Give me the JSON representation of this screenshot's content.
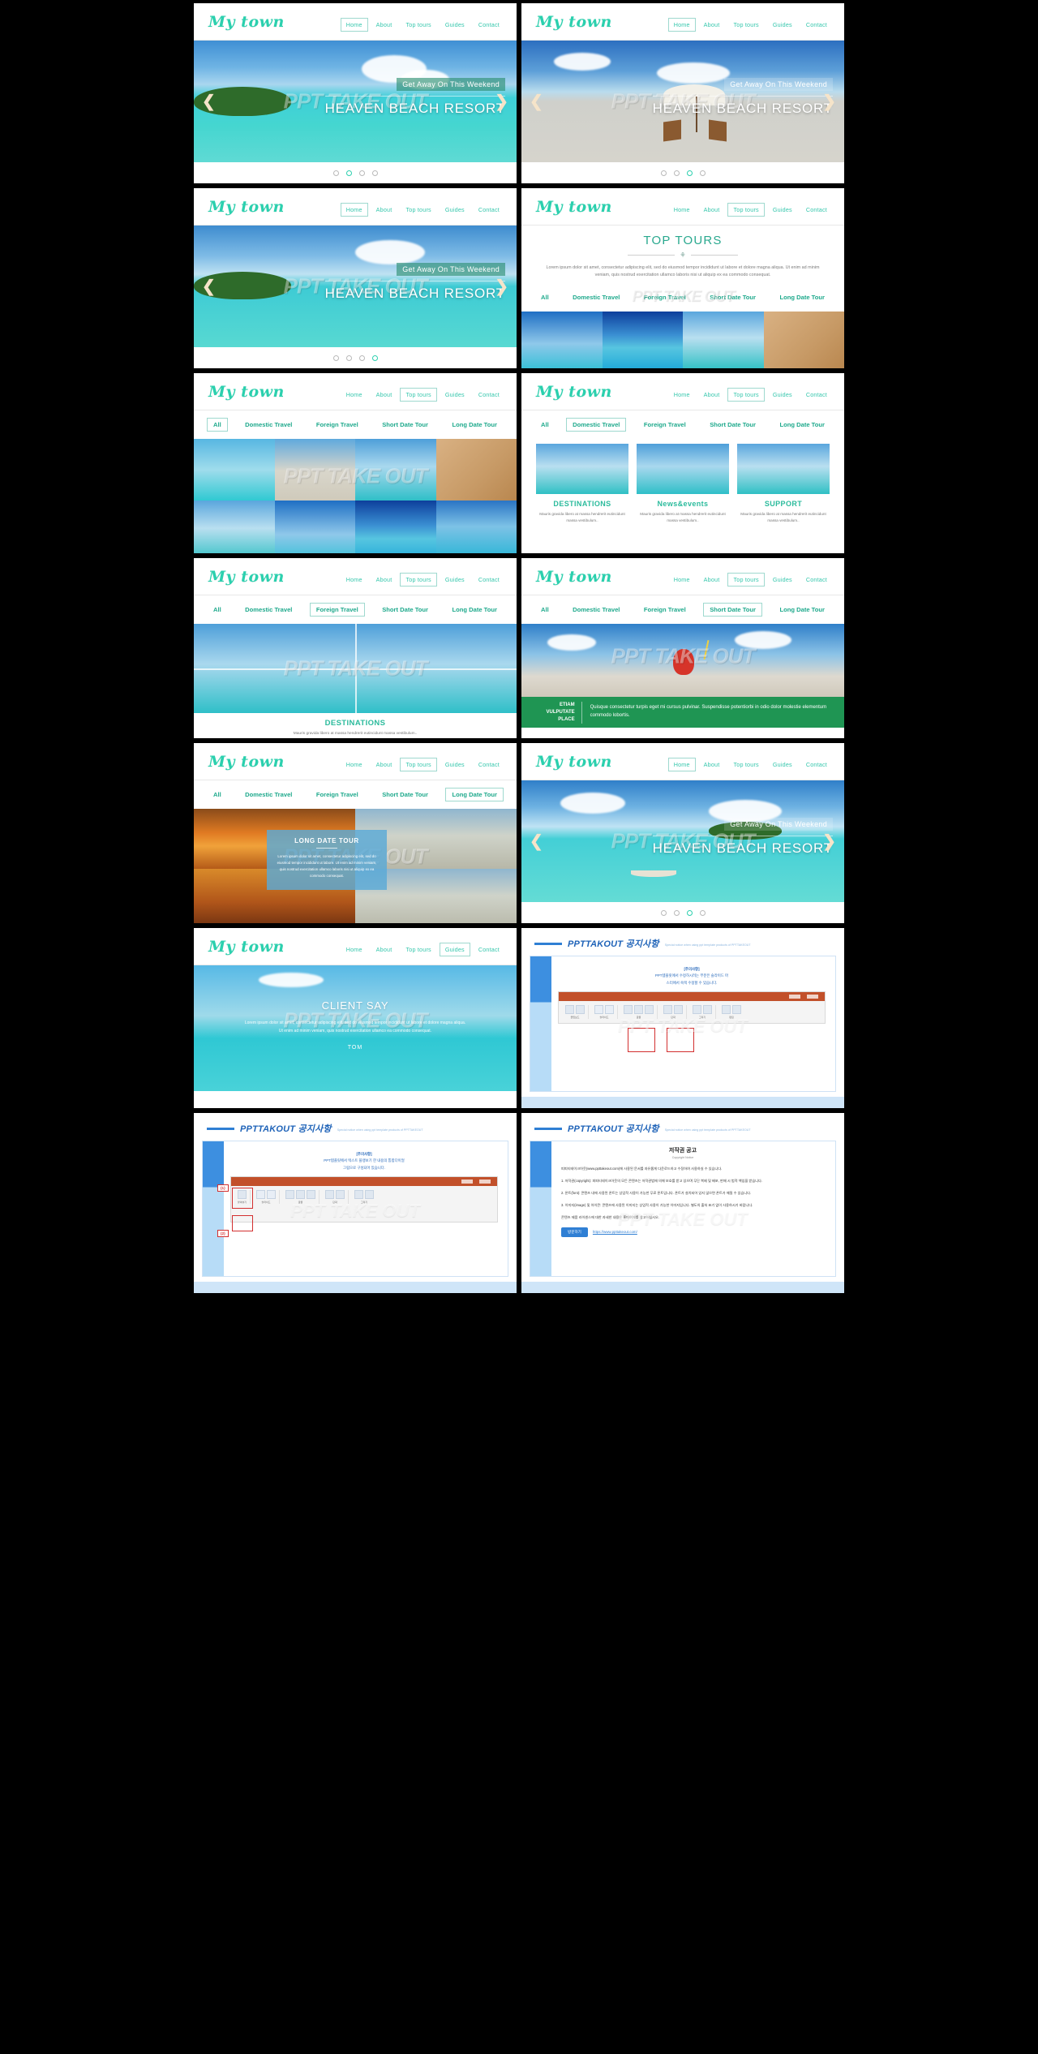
{
  "brand": {
    "logo": "My town"
  },
  "nav": {
    "items": [
      "Home",
      "About",
      "Top tours",
      "Guides",
      "Contact"
    ]
  },
  "hero": {
    "tagline": "Get Away On This Weekend",
    "title": "HEAVEN BEACH RESORT",
    "prev": "❮",
    "next": "❯"
  },
  "watermark": {
    "text": "PPT TAKE OUT"
  },
  "top_tours": {
    "title": "TOP TOURS",
    "ornament": "⚘",
    "description": "Lorem ipsum dolor sit amet, consectetur adipiscing elit, sed do eiusmod tempor incididunt ut labore et dolore magna aliqua. Ut enim ad minim veniam, quis nostrud exercitation ullamco laboris nisi ut aliquip ex ea commodo consequat."
  },
  "filters": {
    "items": [
      "All",
      "Domestic Travel",
      "Foreign Travel",
      "Short Date Tour",
      "Long Date Tour"
    ]
  },
  "features": [
    {
      "title": "DESTINATIONS",
      "text": "Mauris gravida libero at massa hendrerit eutincidunt massa vestibulum.."
    },
    {
      "title": "News&events",
      "text": "Mauris gravida libero at massa hendrerit eutincidunt massa vestibulum.."
    },
    {
      "title": "SUPPORT",
      "text": "Mauris gravida libero at massa hendrerit eutincidunt massa vestibulum.."
    }
  ],
  "destination_banner": {
    "title": "DESTINATIONS",
    "text": "Mauris gravida libero at massa hendrerit eutincidunt massa vestibulum.."
  },
  "etiam": {
    "label_line1": "ETIAM",
    "label_line2": "VULPUTATE PLACE",
    "text": "Quisque consectetur turpis eget mi cursus pulvinar. Suspendisse potentiorbi in odio dolor molestie elementum commodo lobortis."
  },
  "long_date_card": {
    "title": "LONG DATE TOUR",
    "text": "Lorem ipsum dolor sit amet, consectetur adipiscing elit, sed do eiusmod tempor incididunt ut labore. Ut enim ad minim veniam, quis nostrud exercitation ullamco laboris nisi ut aliquip ex ea commodo consequat."
  },
  "client_say": {
    "title": "CLIENT SAY",
    "quote": "Lorem ipsum dolor sit amet, consectetur adipiscing elit, sed do eiusmod tempor incididunt ut labore et dolore magna aliqua. Ut enim ad minim veniam, quis nostrud exercitation ullamco ea commodo consequat.",
    "author": "TOM"
  },
  "notice": {
    "title": "PPTTAKOUT 공지사항",
    "subtitle": "Special notice when using ppt template products of PPTTAKEOUT",
    "slide1": {
      "heading": "[주의사항]",
      "line1": "PPT템플릿에서 수정하시려는 부분은 슬라이드 마",
      "line2": "스터에서 숙택 수정할 수 있습니다.",
      "ribbon_label": "슬라이드 마스터 보기"
    },
    "slide2": {
      "heading": "[주의사항]",
      "line1": "PPT템플릿에서 텍스트 블랭보기 한 내용의 통합다이얼",
      "line2": "그림으로 구성되어 있습니다.",
      "tag1": "(1)",
      "tag2": "(2)",
      "ribbon_label": "화면 마스터"
    },
    "copyright": {
      "title": "저작권 공고",
      "subtitle": "Copyright Notice",
      "intro": "피피티테이크아웃(www.ppttakeout.com)에 사용된 문서를 자유롭게 다운로드하고 수정하여 사용하실 수 있습니다.",
      "p1": "1. 저작권(copyright): 피피티테이크아웃의 모든 콘텐츠는 저작권법에 의해 보호를 받고 있으며 무단 복제 및 배포, 판매 시 법적 책임을 받습니다.",
      "p2": "2. 폰트(font): 콘텐츠 내에 사용된 폰트는 상업적 사용이 가능한 무료 폰트입니다. 폰트가 설치되어 있지 않으면 폰트가 깨질 수 있습니다.",
      "p3": "3. 이미지(image) 및 아이콘: 콘텐츠에 사용된 이미지는 상업적 사용이 가능한 이미지입니다. 별도의 출처 표기 없이 사용하시기 바랍니다.",
      "p4": "콘텐츠 제품 라이센스에 대한 자세한 내용은 홈페이지를 참고하십시오.",
      "button": "방문하기",
      "link": "https://www.ppttakeout.com/"
    }
  },
  "colors": {
    "brand_teal": "#2bd0ae",
    "green_bar": "#1f9553",
    "notice_blue": "#2f7fd4"
  }
}
